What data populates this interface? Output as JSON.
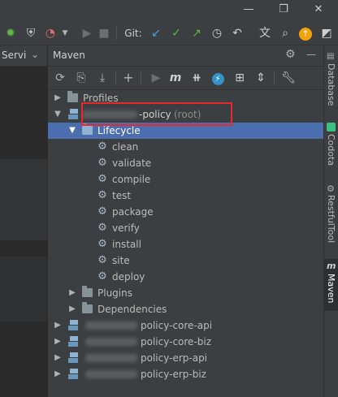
{
  "window": {
    "restore_icon": "❐",
    "close_icon": "✕",
    "minimize_icon": "—"
  },
  "toolbar": {
    "git_label": "Git:"
  },
  "left_panel": {
    "title": "Servi",
    "chevron": "⌄"
  },
  "maven": {
    "title": "Maven",
    "settings_glyph": "⚙",
    "minimize_glyph": "—",
    "tree": {
      "profiles": "Profiles",
      "root": {
        "name": "-policy",
        "suffix": "(root)"
      },
      "lifecycle": "Lifecycle",
      "phases": [
        "clean",
        "validate",
        "compile",
        "test",
        "package",
        "verify",
        "install",
        "site",
        "deploy"
      ],
      "plugins": "Plugins",
      "dependencies": "Dependencies",
      "modules": [
        "policy-core-api",
        "policy-core-biz",
        "policy-erp-api",
        "policy-erp-biz"
      ]
    }
  },
  "right_tabs": [
    "Database",
    "Codota",
    "RestfulTool",
    "Maven"
  ],
  "colors": {
    "selection": "#4b6eaf",
    "highlight_box": "#e5292c",
    "background": "#3c3f41"
  }
}
